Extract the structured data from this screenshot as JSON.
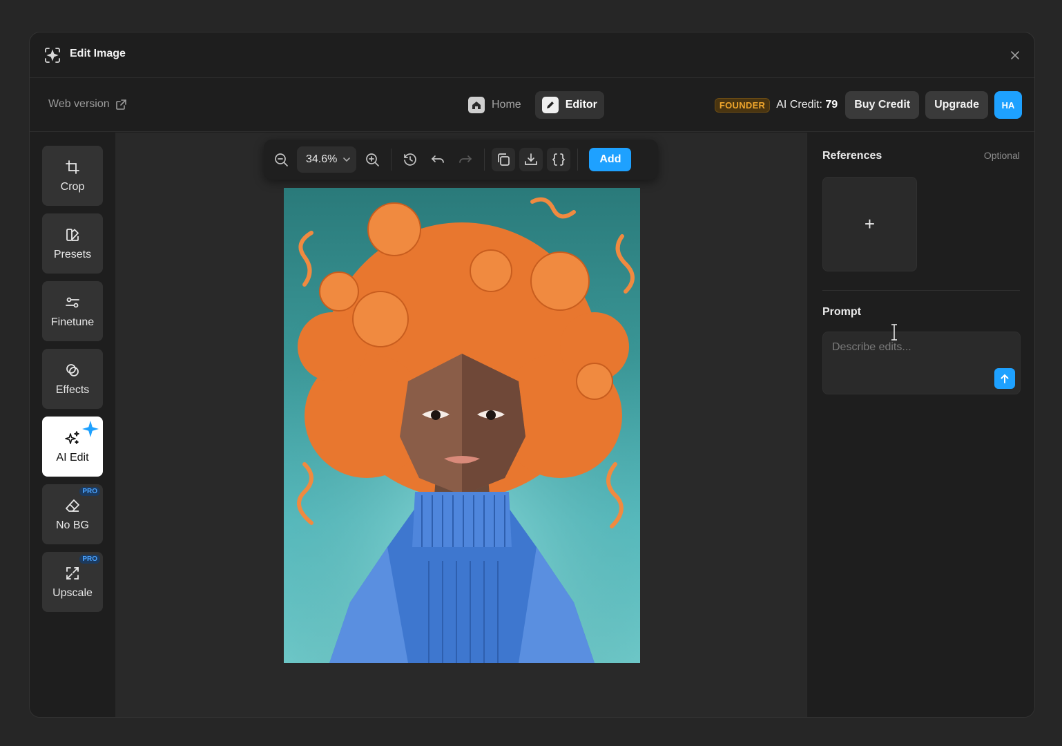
{
  "window": {
    "title": "Edit Image",
    "close_icon": "close-icon"
  },
  "topbar": {
    "web_version": "Web version",
    "nav": [
      {
        "label": "Home",
        "icon": "home-icon",
        "active": false
      },
      {
        "label": "Editor",
        "icon": "edit-icon",
        "active": true
      }
    ],
    "badge": "FOUNDER",
    "credit_label": "AI Credit:",
    "credit_value": "79",
    "buy_credit": "Buy Credit",
    "upgrade": "Upgrade",
    "avatar": "HA"
  },
  "tools": [
    {
      "label": "Crop",
      "icon": "crop-icon"
    },
    {
      "label": "Presets",
      "icon": "presets-icon"
    },
    {
      "label": "Finetune",
      "icon": "sliders-icon"
    },
    {
      "label": "Effects",
      "icon": "effects-icon"
    },
    {
      "label": "AI Edit",
      "icon": "sparkles-icon",
      "active": true
    },
    {
      "label": "No BG",
      "icon": "eraser-icon",
      "badge": "PRO"
    },
    {
      "label": "Upscale",
      "icon": "upscale-icon",
      "badge": "PRO"
    }
  ],
  "toolbar": {
    "zoom": "34.6%",
    "add": "Add"
  },
  "panel": {
    "references_title": "References",
    "optional": "Optional",
    "add_symbol": "+",
    "prompt_title": "Prompt",
    "prompt_placeholder": "Describe edits..."
  },
  "colors": {
    "accent": "#1ea1ff",
    "founder": "#f0a62c",
    "background": "#1e1e1e"
  }
}
